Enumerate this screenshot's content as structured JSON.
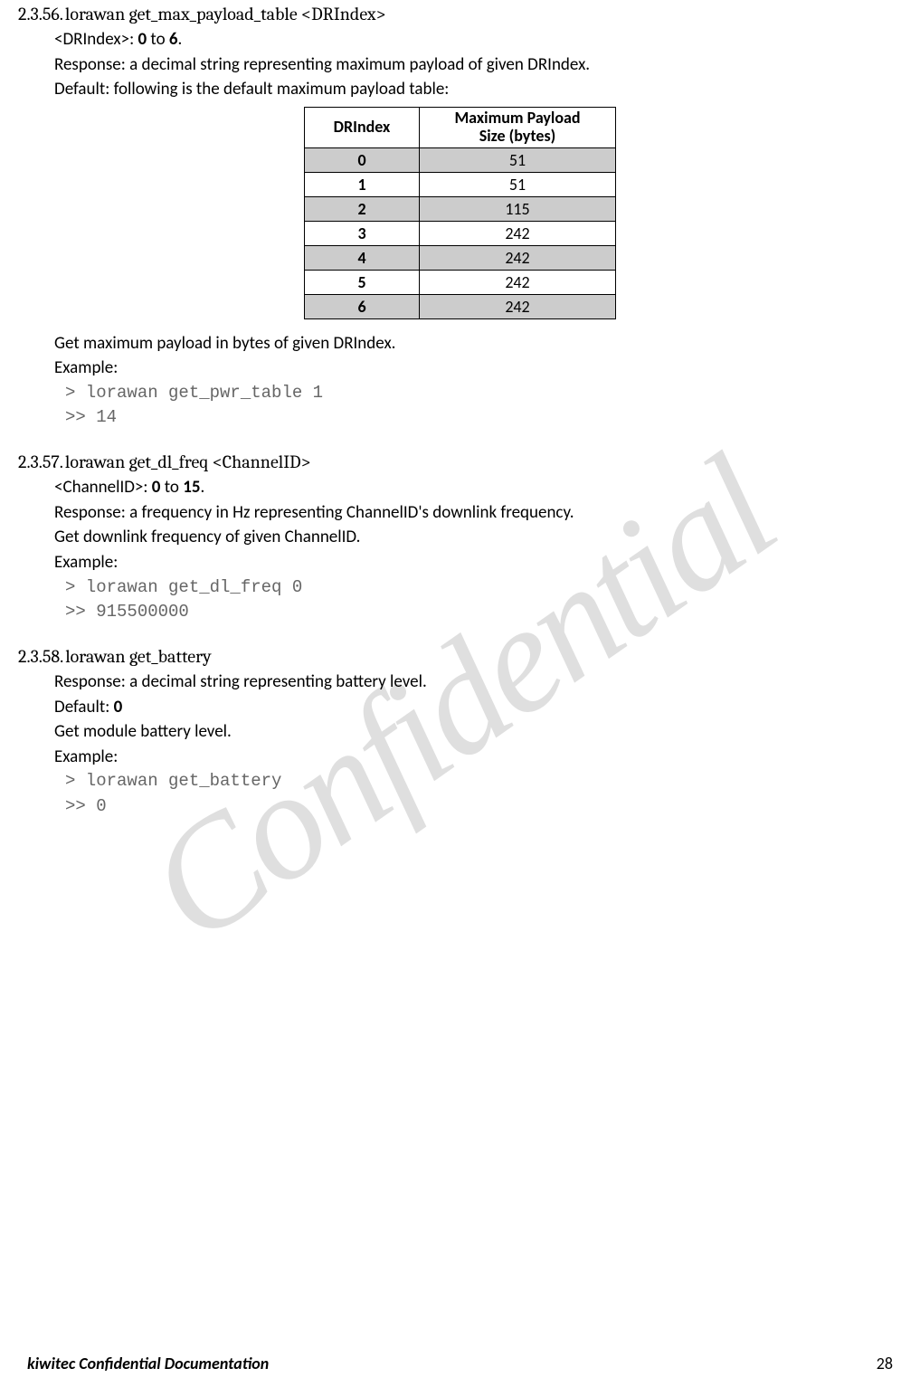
{
  "watermark": "Confidential",
  "sections": {
    "s56": {
      "num": "2.3.56.",
      "title_a": "lorawan get_max_payload_table <DRIndex>",
      "param_label": "<DRIndex>: ",
      "param_range_a": "0",
      "param_to": " to ",
      "param_range_b": "6",
      "param_end": ".",
      "response": "Response: a decimal string representing maximum payload of given DRIndex.",
      "default": "Default: following is the default maximum payload table:",
      "table": {
        "h1": "DRIndex",
        "h2a": "Maximum Payload",
        "h2b": "Size (bytes)",
        "rows": [
          {
            "idx": "0",
            "val": "51"
          },
          {
            "idx": "1",
            "val": "51"
          },
          {
            "idx": "2",
            "val": "115"
          },
          {
            "idx": "3",
            "val": "242"
          },
          {
            "idx": "4",
            "val": "242"
          },
          {
            "idx": "5",
            "val": "242"
          },
          {
            "idx": "6",
            "val": "242"
          }
        ]
      },
      "desc": "Get maximum payload in bytes of given DRIndex.",
      "example_label": "Example:",
      "code1": "> lorawan get_pwr_table 1",
      "code2": ">> 14"
    },
    "s57": {
      "num": "2.3.57.",
      "title_a": "lorawan get_dl_freq <ChannelID>",
      "param_label": "<ChannelID>: ",
      "param_range_a": "0",
      "param_to": " to ",
      "param_range_b": "15",
      "param_end": ".",
      "response": "Response: a frequency in Hz representing ChannelID's downlink frequency.",
      "desc": "Get downlink frequency of given ChannelID.",
      "example_label": "Example:",
      "code1": "> lorawan get_dl_freq 0",
      "code2": ">> 915500000"
    },
    "s58": {
      "num": "2.3.58.",
      "title_a": "lorawan get_battery",
      "response": "Response: a decimal string representing battery level.",
      "default_a": "Default: ",
      "default_b": "0",
      "desc": "Get module battery level.",
      "example_label": "Example:",
      "code1": "> lorawan get_battery",
      "code2": ">> 0"
    }
  },
  "footer": {
    "brand": "kiwitec  Confidential  Documentation",
    "page": "28"
  }
}
